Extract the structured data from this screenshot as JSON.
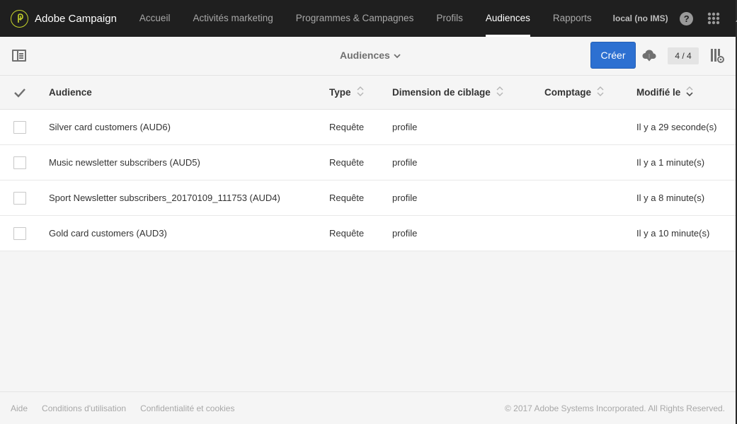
{
  "app": {
    "name": "Adobe Campaign",
    "logo_icon": "adobe-campaign-logo-icon",
    "accent": "#c7d52b"
  },
  "nav": {
    "items": [
      {
        "label": "Accueil",
        "active": false
      },
      {
        "label": "Activités marketing",
        "active": false
      },
      {
        "label": "Programmes & Campagnes",
        "active": false
      },
      {
        "label": "Profils",
        "active": false
      },
      {
        "label": "Audiences",
        "active": true
      },
      {
        "label": "Rapports",
        "active": false
      }
    ],
    "instance": "local (no IMS)",
    "help_glyph": "?",
    "icons": [
      "help-icon",
      "apps-grid-icon",
      "notification-bell-icon",
      "user-avatar-icon"
    ]
  },
  "toolbar": {
    "view_title": "Audiences",
    "create_label": "Créer",
    "count": "4 / 4",
    "primary_color": "#2d70d1"
  },
  "table": {
    "columns": {
      "audience": "Audience",
      "type": "Type",
      "dimension": "Dimension de ciblage",
      "count": "Comptage",
      "modified": "Modifié le"
    },
    "rows": [
      {
        "audience": "Silver card customers (AUD6)",
        "type": "Requête",
        "dimension": "profile",
        "count": "",
        "modified": "Il y a 29 seconde(s)"
      },
      {
        "audience": "Music newsletter subscribers (AUD5)",
        "type": "Requête",
        "dimension": "profile",
        "count": "",
        "modified": "Il y a 1 minute(s)"
      },
      {
        "audience": "Sport Newsletter subscribers_20170109_111753 (AUD4)",
        "type": "Requête",
        "dimension": "profile",
        "count": "",
        "modified": "Il y a 8 minute(s)"
      },
      {
        "audience": "Gold card customers (AUD3)",
        "type": "Requête",
        "dimension": "profile",
        "count": "",
        "modified": "Il y a 10 minute(s)"
      }
    ]
  },
  "footer": {
    "links": [
      "Aide",
      "Conditions d'utilisation",
      "Confidentialité et cookies"
    ],
    "copyright": "© 2017 Adobe Systems Incorporated. All Rights Reserved."
  }
}
